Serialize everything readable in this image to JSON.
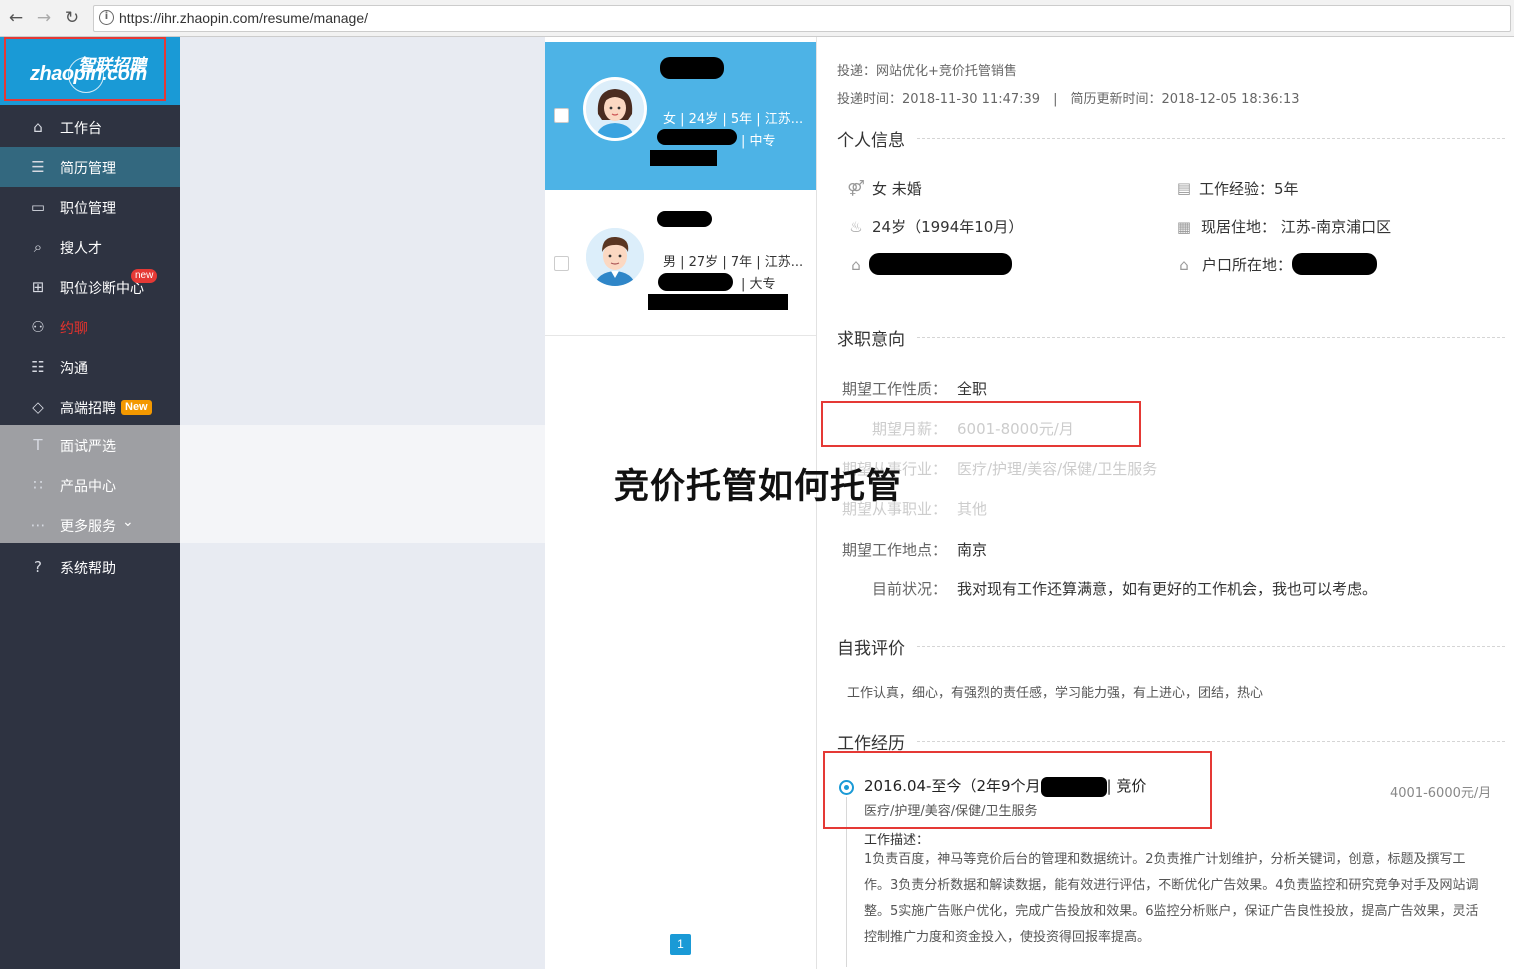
{
  "browser": {
    "back": "←",
    "forward": "→",
    "reload": "↻",
    "info": "i",
    "url": "https://ihr.zhaopin.com/resume/manage/"
  },
  "logo": {
    "cn": "智联招聘",
    "en": "zhaopin.com"
  },
  "sidebar": {
    "items": [
      {
        "label": "工作台",
        "icon": "home-icon",
        "glyph": "⌂"
      },
      {
        "label": "简历管理",
        "icon": "resume-icon",
        "glyph": "☰"
      },
      {
        "label": "职位管理",
        "icon": "folder-icon",
        "glyph": "▭"
      },
      {
        "label": "搜人才",
        "icon": "search-icon",
        "glyph": "⌕"
      },
      {
        "label": "职位诊断中心",
        "icon": "diagnosis-icon",
        "glyph": "⊞",
        "badge": "new"
      },
      {
        "label": "约聊",
        "icon": "people-icon",
        "glyph": "⚇"
      },
      {
        "label": "沟通",
        "icon": "chat-icon",
        "glyph": "☷"
      },
      {
        "label": "高端招聘",
        "icon": "diamond-icon",
        "glyph": "◇",
        "badge": "New"
      },
      {
        "label": "面试严选",
        "icon": "interview-icon",
        "glyph": "T"
      },
      {
        "label": "产品中心",
        "icon": "grid-icon",
        "glyph": "∷"
      },
      {
        "label": "更多服务",
        "icon": "more-icon",
        "glyph": "⋯",
        "chevron": "⌄"
      },
      {
        "label": "系统帮助",
        "icon": "help-icon",
        "glyph": "?"
      }
    ]
  },
  "candidates": [
    {
      "info": "女 | 24岁 | 5年 | 江苏...",
      "edu": "| 中专"
    },
    {
      "info": "男 | 27岁 | 7年 | 江苏...",
      "edu": "| 大专"
    }
  ],
  "pager": {
    "current": "1"
  },
  "detail": {
    "applied_for": "投递：网站优化+竞价托管销售",
    "times": "投递时间：2018-11-30 11:47:39　|　简历更新时间：2018-12-05 18:36:13",
    "personal": {
      "title": "个人信息",
      "gender_marital": "女 未婚",
      "age": "24岁（1994年10月）",
      "experience": "工作经验：5年",
      "residence": "现居住地： 江苏-南京浦口区",
      "hukou": "户口所在地："
    },
    "intent": {
      "title": "求职意向",
      "rows": [
        {
          "label": "期望工作性质：",
          "value": "全职"
        },
        {
          "label": "期望月薪：",
          "value": "6001-8000元/月"
        },
        {
          "label": "期望从事行业：",
          "value": "医疗/护理/美容/保健/卫生服务"
        },
        {
          "label": "期望从事职业：",
          "value": "其他"
        },
        {
          "label": "期望工作地点：",
          "value": "南京"
        },
        {
          "label": "目前状况：",
          "value": "我对现有工作还算满意，如有更好的工作机会，我也可以考虑。"
        }
      ]
    },
    "self_eval": {
      "title": "自我评价",
      "text": "工作认真，细心，有强烈的责任感，学习能力强，有上进心，团结，热心"
    },
    "work": {
      "title": "工作经历",
      "period": "2016.04-至今（2年9个月",
      "role": "| 竞价",
      "industry": "医疗/护理/美容/保健/卫生服务",
      "salary": "4001-6000元/月",
      "desc_label": "工作描述：",
      "desc": "1负责百度，神马等竞价后台的管理和数据统计。2负责推广计划维护，分析关键词，创意，标题及撰写工作。3负责分析数据和解读数据，能有效进行评估，不断优化广告效果。4负责监控和研究竞争对手及网站调整。5实施广告账户优化，完成广告投放和效果。6监控分析账户，保证广告良性投放，提高广告效果，灵活控制推广力度和资金投入，使投资得回报率提高。"
    }
  },
  "overlay_title": "竞价托管如何托管"
}
